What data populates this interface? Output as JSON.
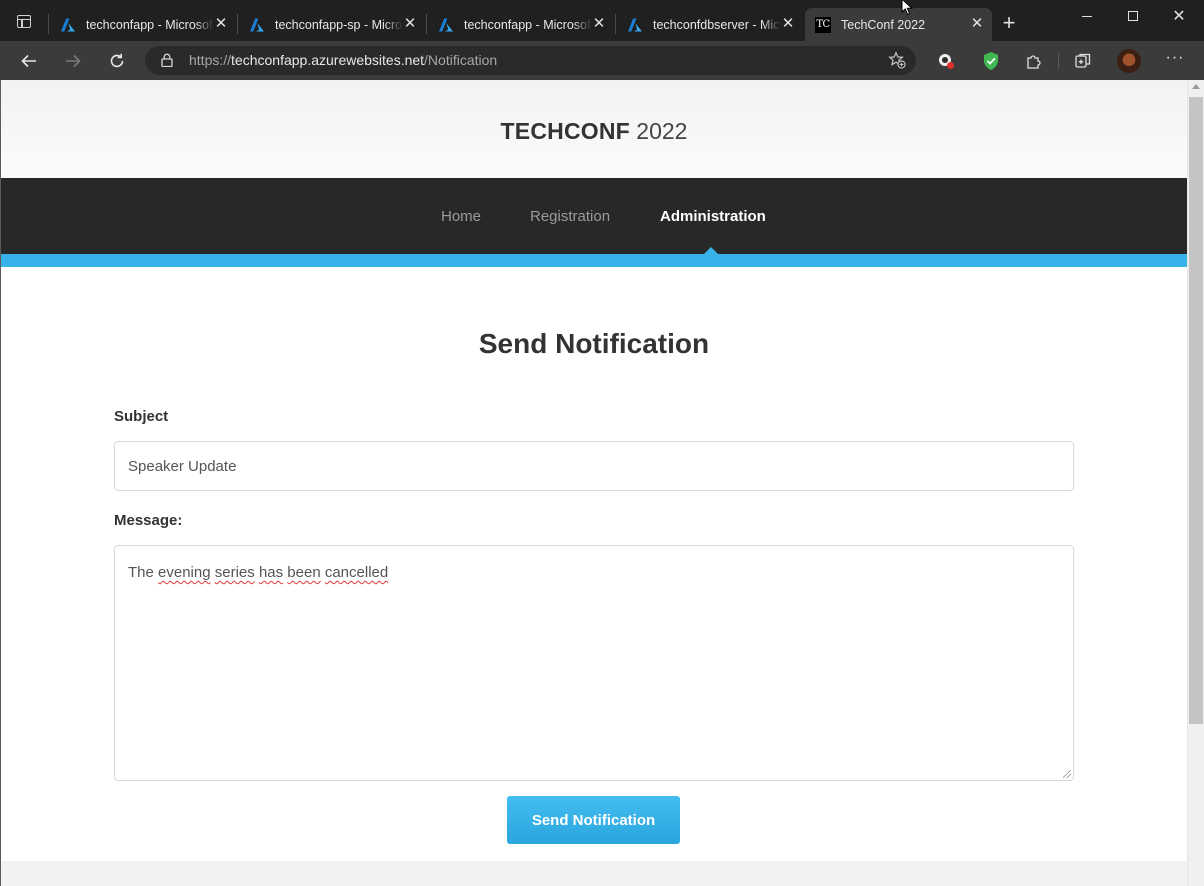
{
  "browser": {
    "tabs": [
      {
        "label": "techconfapp - Microsoft Azure",
        "favicon": "azure-icon",
        "active": false
      },
      {
        "label": "techconfapp-sp - Microsoft Azure",
        "favicon": "azure-icon",
        "active": false
      },
      {
        "label": "techconfapp - Microsoft Azure",
        "favicon": "azure-icon",
        "active": false
      },
      {
        "label": "techconfdbserver - Microsoft Azure",
        "favicon": "azure-icon",
        "active": false
      },
      {
        "label": "TechConf 2022",
        "favicon": "techconf-icon",
        "favicon_text": "TC",
        "active": true
      }
    ],
    "address": {
      "scheme": "https://",
      "host": "techconfapp.azurewebsites.net",
      "path": "/Notification"
    },
    "colors": {
      "frame": "#202020",
      "active_tab": "#3b3b3b"
    }
  },
  "site": {
    "brand": "TECHCONF",
    "year": " 2022",
    "nav": [
      {
        "label": "Home",
        "active": false
      },
      {
        "label": "Registration",
        "active": false
      },
      {
        "label": "Administration",
        "active": true
      }
    ],
    "colors": {
      "accent": "#37b3ea",
      "nav_bg": "#282828"
    }
  },
  "form": {
    "heading": "Send Notification",
    "subject_label": "Subject",
    "subject_value": "Speaker Update",
    "message_label": "Message:",
    "message_words": [
      "The",
      " ",
      "evening",
      " ",
      "series",
      " ",
      "has",
      " ",
      "been",
      " ",
      "cancelled"
    ],
    "submit_label": "Send Notification"
  }
}
